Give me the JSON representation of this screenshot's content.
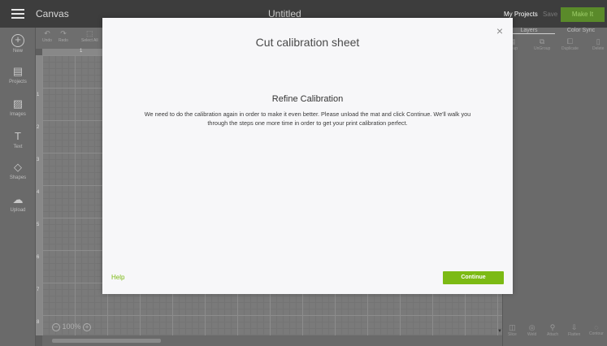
{
  "topbar": {
    "app_name": "Canvas",
    "document_title": "Untitled",
    "my_projects_label": "My Projects",
    "save_label": "Save",
    "make_it_label": "Make It"
  },
  "left_tools": [
    {
      "label": "New",
      "icon": "plus-circle-icon"
    },
    {
      "label": "Projects",
      "icon": "projects-icon"
    },
    {
      "label": "Images",
      "icon": "image-icon"
    },
    {
      "label": "Text",
      "icon": "text-icon"
    },
    {
      "label": "Shapes",
      "icon": "shapes-icon"
    },
    {
      "label": "Upload",
      "icon": "upload-icon"
    }
  ],
  "edit_toolbar": {
    "undo_label": "Undo",
    "redo_label": "Redo",
    "select_all_label": "Select All"
  },
  "rulers": {
    "top_first": "1",
    "left": [
      "1",
      "2",
      "3",
      "4",
      "5",
      "6",
      "7",
      "8"
    ]
  },
  "zoom": {
    "level": "100%"
  },
  "right_panel": {
    "tabs": [
      "Layers",
      "Color Sync"
    ],
    "actions": [
      "Group",
      "UnGroup",
      "Duplicate",
      "Delete"
    ],
    "bottom_actions": [
      "Slice",
      "Weld",
      "Attach",
      "Flatten",
      "Contour"
    ]
  },
  "modal": {
    "title": "Cut calibration sheet",
    "heading": "Refine Calibration",
    "body": "We need to do the calibration again in order to make it even better. Please unload the mat and click Continue. We'll walk you through the steps one more time in order to get your print calibration perfect.",
    "help_label": "Help",
    "continue_label": "Continue",
    "close_glyph": "×"
  },
  "colors": {
    "accent_green": "#7cba14",
    "topbar": "#3d3d3d",
    "modal_background": "#f7f7f9"
  }
}
